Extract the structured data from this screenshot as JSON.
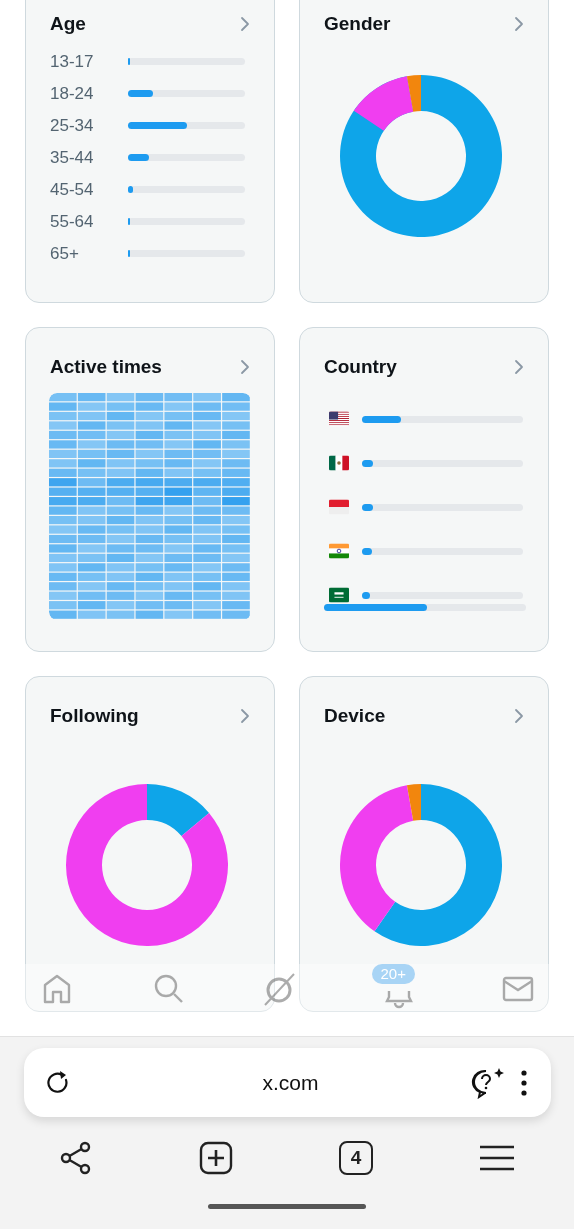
{
  "cards": [
    {
      "kind": "age",
      "title": "Age",
      "rows": [
        {
          "label": "13-17",
          "level": 0.01
        },
        {
          "label": "18-24",
          "level": 0.22
        },
        {
          "label": "25-34",
          "level": 0.51
        },
        {
          "label": "35-44",
          "level": 0.18
        },
        {
          "label": "45-54",
          "level": 0.05
        },
        {
          "label": "55-64",
          "level": 0.01
        },
        {
          "label": "65+",
          "level": 0.01
        }
      ]
    },
    {
      "kind": "gender",
      "title": "Gender"
    },
    {
      "kind": "heatmap",
      "title": "Active times"
    },
    {
      "kind": "country",
      "title": "Country",
      "rows": [
        {
          "level": 0.24
        },
        {
          "level": 0.07
        },
        {
          "level": 0.07
        },
        {
          "level": 0.06
        },
        {
          "level": 0.05
        }
      ],
      "total": {
        "level": 0.51
      }
    },
    {
      "kind": "following",
      "title": "Following"
    },
    {
      "kind": "device",
      "title": "Device"
    }
  ],
  "bottom_nav": {
    "badge": "20+"
  },
  "browser": {
    "url": "x.com",
    "tab_count": "4"
  }
}
